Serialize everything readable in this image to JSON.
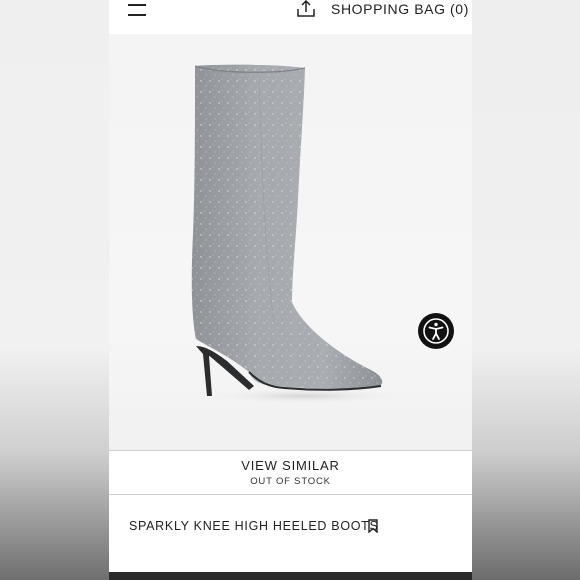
{
  "header": {
    "bag_label": "SHOPPING BAG (0)",
    "icons": [
      "menu-icon",
      "share-upload-icon"
    ]
  },
  "product_image": {
    "subject": "boot-image",
    "accessibility_icon": "accessibility-icon"
  },
  "view_similar": {
    "label": "VIEW SIMILAR",
    "status": "OUT OF STOCK"
  },
  "product": {
    "name": "SPARKLY KNEE HIGH HEELED BOOTS",
    "save_icon": "bookmark-icon"
  },
  "colors": {
    "text": "#222222",
    "boot_fabric": "#a2a6aa",
    "accessibility_button": "#111111",
    "divider": "#cfcfcf"
  }
}
